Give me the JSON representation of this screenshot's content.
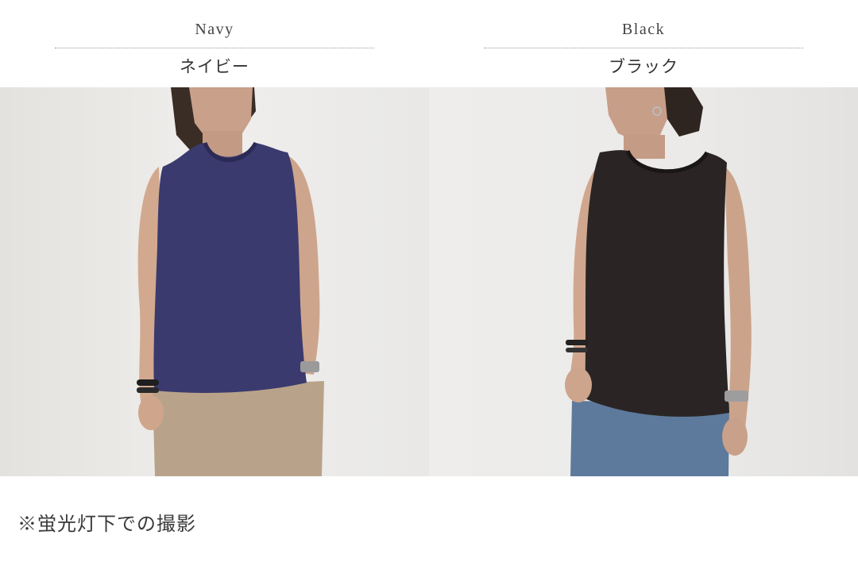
{
  "colors": [
    {
      "english": "Navy",
      "japanese": "ネイビー",
      "garment_color": "#3b3a6e",
      "pants_color": "#b8a38a"
    },
    {
      "english": "Black",
      "japanese": "ブラック",
      "garment_color": "#2a2524",
      "pants_color": "#5d7a9c"
    }
  ],
  "note": "※蛍光灯下での撮影"
}
